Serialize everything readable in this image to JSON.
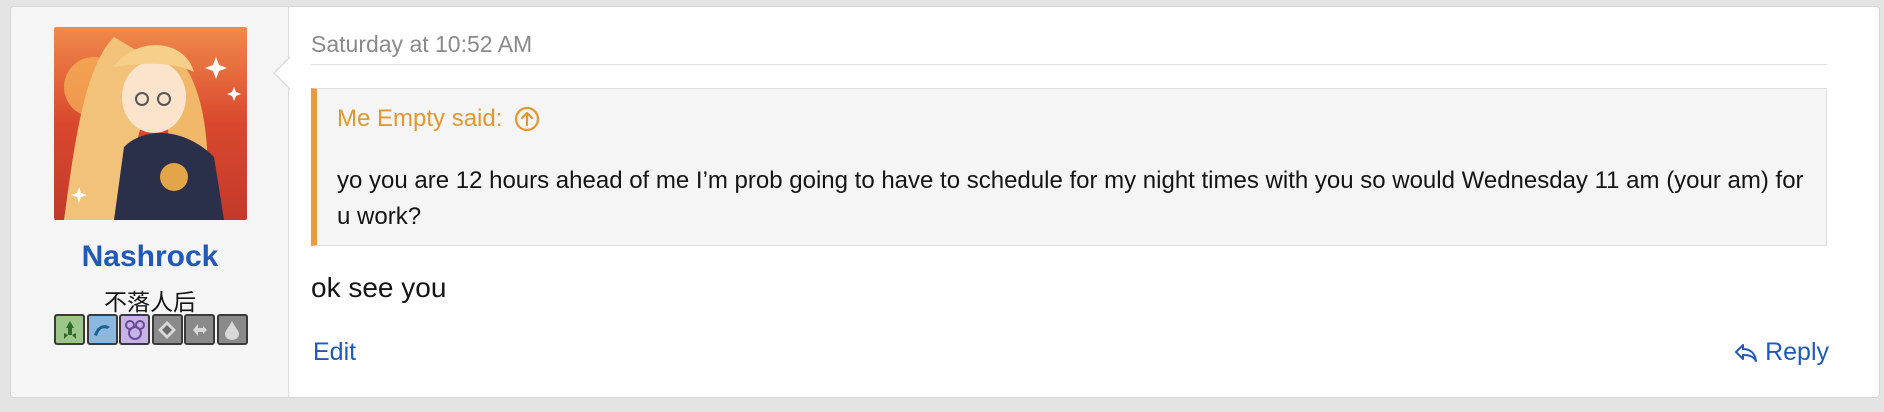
{
  "user": {
    "name": "Nashrock",
    "title": "不落人后",
    "avatar_icon": "anime-character-avatar",
    "badges": [
      {
        "icon": "rocket-badge-icon",
        "color": "#7fb06a"
      },
      {
        "icon": "wave-badge-icon",
        "color": "#5aa0c8"
      },
      {
        "icon": "mouse-badge-icon",
        "color": "#a88ac8"
      },
      {
        "icon": "diamond-badge-icon",
        "color": "#9a9a9a"
      },
      {
        "icon": "cycle-badge-icon",
        "color": "#9a9a9a"
      },
      {
        "icon": "drop-badge-icon",
        "color": "#9a9a9a"
      }
    ]
  },
  "post": {
    "timestamp": "Saturday at 10:52 AM",
    "quote": {
      "author_label": "Me Empty said:",
      "jump_icon": "arrow-up-circle-icon",
      "text": "yo you are 12 hours ahead of me I’m prob going to have to schedule for my night times with you so would Wednesday 11 am (your am) for u work?"
    },
    "message": "ok see you",
    "actions": {
      "edit_label": "Edit",
      "reply_label": "Reply",
      "reply_icon": "reply-arrow-icon"
    }
  },
  "colors": {
    "link": "#2059b8",
    "quote_accent": "#e89a3c",
    "quote_head": "#e3972e",
    "muted": "#8a8a8a"
  }
}
